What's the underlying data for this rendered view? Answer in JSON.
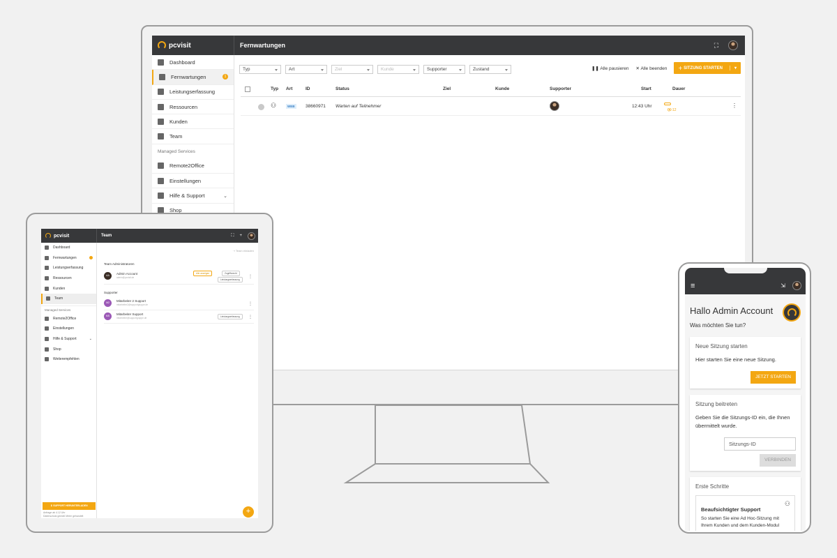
{
  "desktop": {
    "brand": "pcvisit",
    "page_title": "Fernwartungen",
    "sidebar": {
      "items": [
        {
          "label": "Dashboard"
        },
        {
          "label": "Fernwartungen",
          "badge": "1"
        },
        {
          "label": "Leistungserfassung"
        },
        {
          "label": "Ressourcen"
        },
        {
          "label": "Kunden"
        },
        {
          "label": "Team"
        }
      ],
      "section_label": "Managed Services",
      "items2": [
        {
          "label": "Remote2Office"
        },
        {
          "label": "Einstellungen"
        },
        {
          "label": "Hilfe & Support"
        },
        {
          "label": "Shop"
        }
      ]
    },
    "filters": [
      "Typ",
      "Art",
      "Ziel",
      "Kunde",
      "Supporter",
      "Zustand"
    ],
    "actions": {
      "pause_all": "Alle pausieren",
      "end_all": "Alle beenden",
      "start_session": "SITZUNG STARTEN"
    },
    "table": {
      "headers": [
        "Typ",
        "Art",
        "ID",
        "Status",
        "Ziel",
        "Kunde",
        "Supporter",
        "Start",
        "Dauer"
      ],
      "rows": [
        {
          "art": "WEB",
          "id": "38660971",
          "status": "Warten auf Teilnehmer",
          "start": "12:43 Uhr",
          "dauer": "00:12"
        }
      ]
    }
  },
  "tablet": {
    "brand": "pcvisit",
    "page_title": "Team",
    "invite": "Team einladen",
    "sidebar": {
      "items": [
        "Dashboard",
        "Fernwartungen",
        "Leistungserfassung",
        "Ressourcen",
        "Kunden",
        "Team"
      ],
      "section_label": "Managed Services",
      "items2": [
        "Remote2Office",
        "Einstellungen",
        "Hilfe & Support",
        "Shop",
        "Weiterempfehlen"
      ],
      "download": "SUPPORT HERUNTERLADEN",
      "footer1": "Anfrage ab 4.12 Uhr",
      "footer2": "Datenschutz gemäß Meier gehandelt"
    },
    "admins_heading": "Team Administratoren",
    "admin": {
      "initials": "AA",
      "name": "Admin Account",
      "email": "admin@pcvisit.de",
      "chip1": "Alle anzeigen",
      "chip2": "Zugriffsrecht",
      "chip3": "Leistungserfassung"
    },
    "supporter_heading": "Supporter",
    "supporters": [
      {
        "initials": "M2",
        "name": "Mitarbeiter 2 Support",
        "email": "mitarbeiter2@supportgruppe.de"
      },
      {
        "initials": "MS",
        "name": "Mitarbeiter Support",
        "email": "mitarbeiter@supportgruppe.de",
        "chip": "Leistungserfassung"
      }
    ]
  },
  "phone": {
    "greeting": "Hallo Admin Account",
    "question": "Was möchten Sie tun?",
    "new_session": {
      "title": "Neue Sitzung starten",
      "text": "Hier starten Sie eine neue Sitzung.",
      "button": "JETZT STARTEN"
    },
    "join_session": {
      "title": "Sitzung beitreten",
      "text": "Geben Sie die Sitzungs-ID ein, die Ihnen übermittelt wurde.",
      "placeholder": "Sitzungs-ID",
      "button": "VERBINDEN"
    },
    "first_steps": {
      "title": "Erste Schritte",
      "card_title": "Beaufsichtigter Support",
      "card_text": "So starten Sie eine Ad Hoc-Sitzung mit Ihrem Kunden und dem Kunden-Modul"
    }
  },
  "colors": {
    "accent": "#f3a712",
    "topbar": "#37383a"
  }
}
